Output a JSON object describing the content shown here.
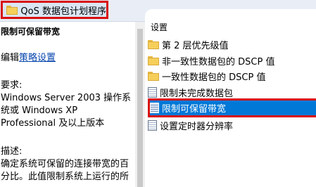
{
  "window": {
    "title": "QoS 数据包计划程序",
    "title_icon": "folder-icon"
  },
  "description_pane": {
    "heading": "限制可保留带宽",
    "edit_prefix": "编辑",
    "edit_link": "策略设置",
    "requirements_label": "要求:",
    "requirements_lines": [
      "Windows Server 2003 操作系",
      "统或 Windows XP",
      "Professional 及以上版本"
    ],
    "description_label": "描述:",
    "description_lines": [
      "确定系统可保留的连接带宽的百",
      "分比。此值限制系统上运行的所"
    ]
  },
  "list_pane": {
    "column_header": "设置",
    "items": [
      {
        "label": "第 2 层优先级值",
        "icon": "folder-icon",
        "selected": false
      },
      {
        "label": "非一致性数据包的 DSCP 值",
        "icon": "folder-icon",
        "selected": false
      },
      {
        "label": "一致性数据包的 DSCP 值",
        "icon": "folder-icon",
        "selected": false
      },
      {
        "label": "限制未完成数据包",
        "icon": "setting-icon",
        "selected": false
      },
      {
        "label": "限制可保留带宽",
        "icon": "setting-icon",
        "selected": true
      },
      {
        "label": "设置定时器分辨率",
        "icon": "setting-icon",
        "selected": false
      }
    ]
  },
  "colors": {
    "highlight": "#0078d7",
    "annotation_box": "#d81010",
    "link": "#0645ad"
  }
}
